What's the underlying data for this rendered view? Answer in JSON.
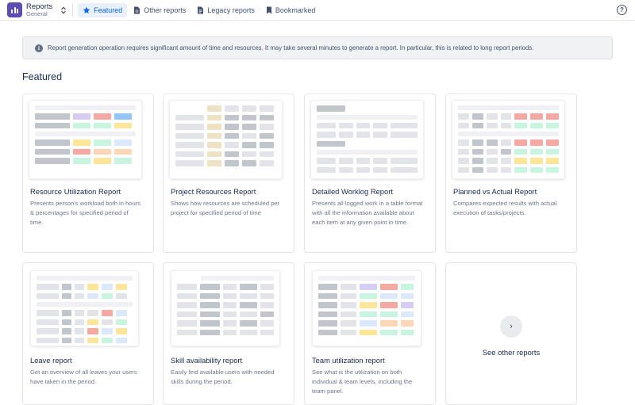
{
  "app": {
    "title": "Reports",
    "subtitle": "General",
    "switch_icon": "chevron-up-down-icon"
  },
  "nav": [
    {
      "label": "Featured",
      "icon": "star-icon",
      "active": true
    },
    {
      "label": "Other reports",
      "icon": "document-icon",
      "active": false
    },
    {
      "label": "Legacy reports",
      "icon": "archive-document-icon",
      "active": false
    },
    {
      "label": "Bookmarked",
      "icon": "bookmark-icon",
      "active": false
    }
  ],
  "help_label": "?",
  "banner": {
    "icon": "info-icon",
    "icon_glyph": "i",
    "text": "Report generation operation requires significant amount of time and resources. It may take several minutes to generate a report. In particular, this is related to long report periods."
  },
  "section_title": "Featured",
  "cards": [
    {
      "title": "Resource Utilization Report",
      "description": "Presents person's workload both in hours & percentages for specified period of time."
    },
    {
      "title": "Project Resources Report",
      "description": "Shows how resources are scheduled per project for specified period of time"
    },
    {
      "title": "Detailed Worklog Report",
      "description": "Presents all logged work in a table format with all the information available about each item at any given point in time."
    },
    {
      "title": "Planned vs Actual Report",
      "description": "Compares expected results with actual execution of tasks/projects."
    },
    {
      "title": "Leave report",
      "description": "Get an overview of all leaves your users have taken in the period."
    },
    {
      "title": "Skill availability report",
      "description": "Easily find available users with needed skills during the period."
    },
    {
      "title": "Team utilization report",
      "description": "See what is the utilization on both individual & team levels, including the team panel."
    }
  ],
  "other_reports": {
    "label": "See other reports",
    "arrow": "›"
  },
  "colors": {
    "accent": "#0c66e4",
    "logo": "#5e4db2",
    "active_tab_bg": "#e9f0fb"
  }
}
